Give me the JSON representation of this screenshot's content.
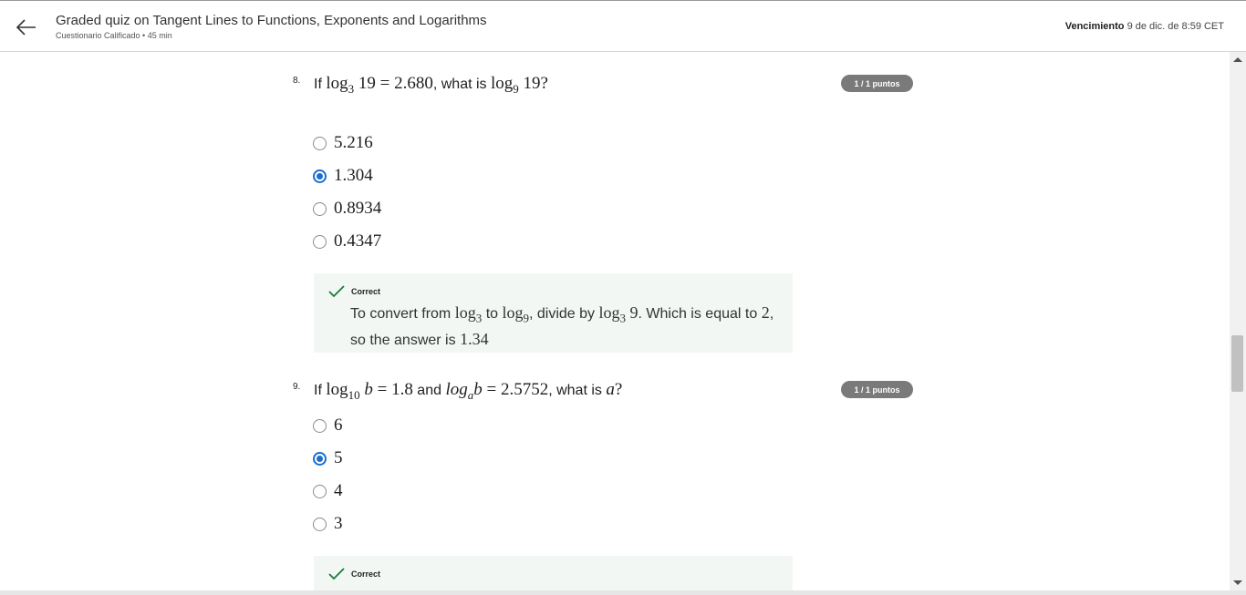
{
  "header": {
    "title": "Graded quiz on Tangent Lines to Functions, Exponents and Logarithms",
    "subtitle": "Cuestionario Calificado • 45 min",
    "due_label": "Vencimiento",
    "due_value": "9 de dic. de 8:59 CET"
  },
  "questions": [
    {
      "number": "8.",
      "text_if": "If",
      "expr1": "= 2.680",
      "text_what": ", what is",
      "expr2_tail": "19?",
      "points": "1 / 1 puntos",
      "options": [
        "5.216",
        "1.304",
        "0.8934",
        "0.4347"
      ],
      "selected_index": 1,
      "feedback": {
        "label": "Correct",
        "t1": "To convert from",
        "t2": "to",
        "t3": ", divide by",
        "t4": ". Which is equal to",
        "t5": ", so the answer is",
        "v_two": "2",
        "v_answer": "1.34"
      }
    },
    {
      "number": "9.",
      "text_if": "If",
      "text_and": "and",
      "expr1": "= 1.8",
      "expr2": "= 2.5752",
      "text_what": ", what is",
      "points": "1 / 1 puntos",
      "options": [
        "6",
        "5",
        "4",
        "3"
      ],
      "selected_index": 1,
      "feedback": {
        "label": "Correct"
      }
    }
  ],
  "colors": {
    "accent": "#1a6fd1",
    "badge": "#7a7a7a",
    "feedback_bg": "#f2f7f4",
    "check": "#1b7a3e"
  }
}
